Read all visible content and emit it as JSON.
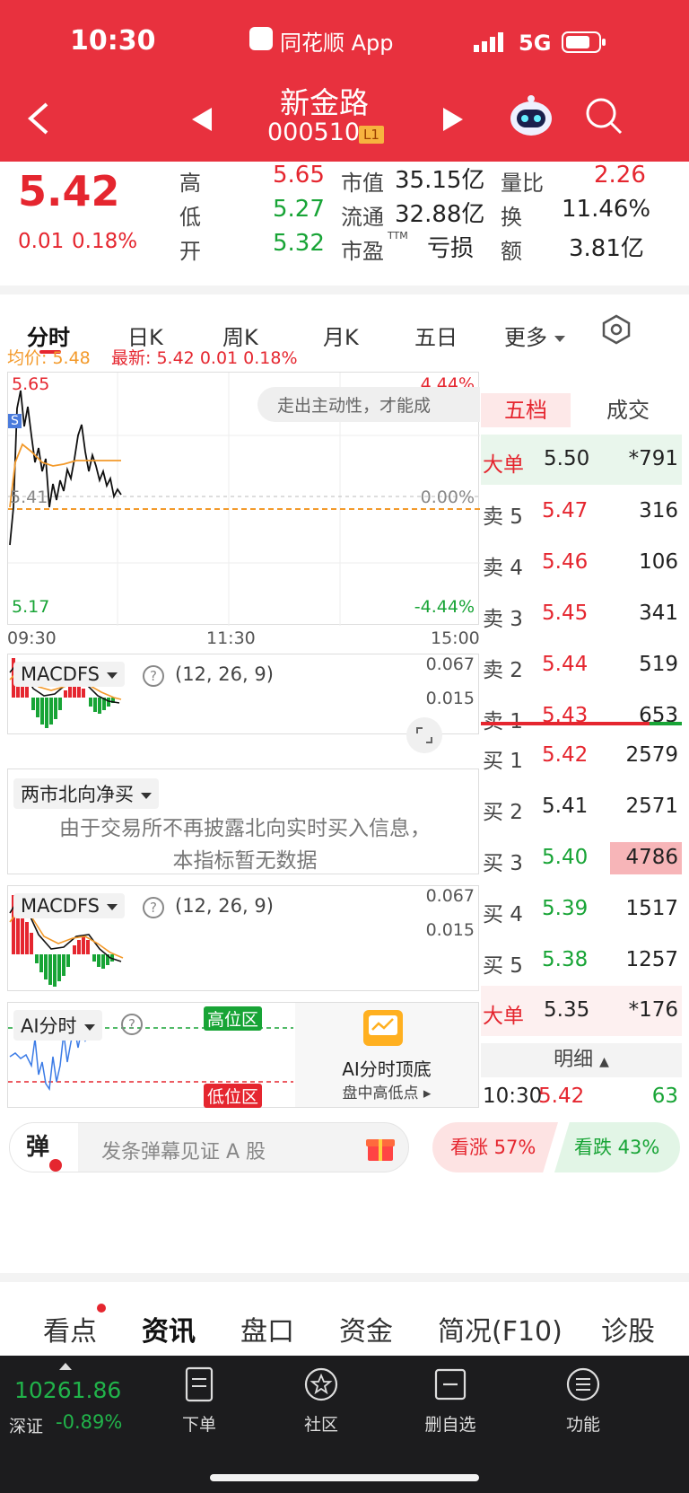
{
  "status_bar": {
    "time": "10:30",
    "app_label": "同花顺 App",
    "network": "5G"
  },
  "header": {
    "stock_name": "新金路",
    "stock_code": "000510",
    "level_badge": "L1"
  },
  "quote": {
    "price": "5.42",
    "change": "0.01",
    "change_pct": "0.18%",
    "high_label": "高",
    "high": "5.65",
    "low_label": "低",
    "low": "5.27",
    "open_label": "开",
    "open": "5.32",
    "mktcap_label": "市值",
    "mktcap": "35.15亿",
    "float_label": "流通",
    "float": "32.88亿",
    "pe_label": "市盈",
    "pe_sup": "TTM",
    "pe": "亏损",
    "volratio_label": "量比",
    "volratio": "2.26",
    "turnover_label": "换",
    "turnover": "11.46%",
    "amount_label": "额",
    "amount": "3.81亿"
  },
  "tabs": [
    {
      "label": "分时"
    },
    {
      "label": "日K"
    },
    {
      "label": "周K"
    },
    {
      "label": "月K"
    },
    {
      "label": "五日"
    },
    {
      "label": "更多"
    }
  ],
  "intraday": {
    "avg_label": "均价:",
    "avg_value": "5.48",
    "latest_label": "最新:",
    "latest_value": "5.42",
    "latest_change": "0.01",
    "latest_pct": "0.18%",
    "top_price": "5.65",
    "top_pct": "4.44%",
    "mid_price": "5.41",
    "mid_pct": "0.00%",
    "bottom_price": "5.17",
    "bottom_pct": "-4.44%",
    "time_start": "09:30",
    "time_mid": "11:30",
    "time_end": "15:00",
    "tooltip": "走出主动性，才能成",
    "s_badge": "S"
  },
  "macd1": {
    "name": "MACDFS",
    "params": "(12, 26, 9)",
    "val_top": "0.067",
    "val_mid": "0.015"
  },
  "northbound": {
    "name": "两市北向净买",
    "msg_line1": "由于交易所不再披露北向实时买入信息，",
    "msg_line2": "本指标暂无数据"
  },
  "macd2": {
    "name": "MACDFS",
    "params": "(12, 26, 9)",
    "val_top": "0.067",
    "val_mid": "0.015"
  },
  "ai": {
    "name": "AI分时",
    "high_zone": "高位区",
    "low_zone": "低位区",
    "promo_title": "AI分时顶底",
    "promo_sub": "盘中高低点"
  },
  "book": {
    "tab_active": "五档",
    "tab_other": "成交",
    "big_sell": {
      "label": "大单",
      "price": "5.50",
      "vol": "*791"
    },
    "asks": [
      {
        "label": "卖 5",
        "price": "5.47",
        "vol": "316"
      },
      {
        "label": "卖 4",
        "price": "5.46",
        "vol": "106"
      },
      {
        "label": "卖 3",
        "price": "5.45",
        "vol": "341"
      },
      {
        "label": "卖 2",
        "price": "5.44",
        "vol": "519"
      },
      {
        "label": "卖 1",
        "price": "5.43",
        "vol": "653"
      }
    ],
    "bids": [
      {
        "label": "买 1",
        "price": "5.42",
        "vol": "2579"
      },
      {
        "label": "买 2",
        "price": "5.41",
        "vol": "2571"
      },
      {
        "label": "买 3",
        "price": "5.40",
        "vol": "4786"
      },
      {
        "label": "买 4",
        "price": "5.39",
        "vol": "1517"
      },
      {
        "label": "买 5",
        "price": "5.38",
        "vol": "1257"
      }
    ],
    "big_buy": {
      "label": "大单",
      "price": "5.35",
      "vol": "*176"
    },
    "detail_label": "明细",
    "last_trade": {
      "time": "10:30",
      "price": "5.42",
      "vol": "63"
    }
  },
  "danmu": {
    "icon_char": "弹",
    "placeholder": "发条弹幕见证 A 股",
    "bull": "看涨 57%",
    "bear": "看跌 43%",
    "bull_value": 57,
    "bear_value": 43
  },
  "bottom_tabs": [
    {
      "label": "看点"
    },
    {
      "label": "资讯"
    },
    {
      "label": "盘口"
    },
    {
      "label": "资金"
    },
    {
      "label": "简况(F10)"
    },
    {
      "label": "诊股"
    }
  ],
  "footer": {
    "index_value": "10261.86",
    "index_name": "深证",
    "index_change": "-0.89%",
    "items": [
      {
        "label": "下单"
      },
      {
        "label": "社区"
      },
      {
        "label": "删自选"
      },
      {
        "label": "功能"
      }
    ]
  },
  "colors": {
    "header_red": "#e8313e",
    "up_red": "#e5262f",
    "down_green": "#18a436",
    "avg_orange": "#f39a2b"
  }
}
